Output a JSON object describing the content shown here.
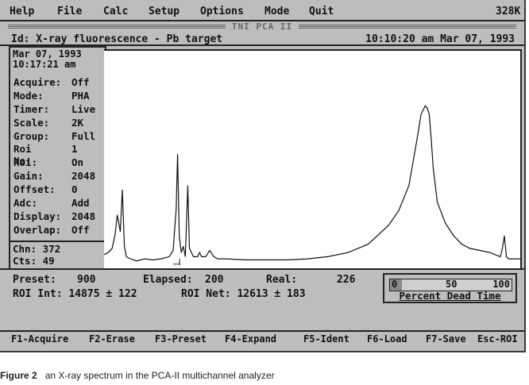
{
  "menu": {
    "items": [
      "Help",
      "File",
      "Calc",
      "Setup",
      "Options",
      "Mode",
      "Quit"
    ],
    "memory": "328K"
  },
  "app_title": "TNI PCA II",
  "header": {
    "id_line": "Id: X-ray fluorescence - Pb target",
    "clock": "10:10:20 am Mar 07, 1993"
  },
  "status": {
    "date": "Mar 07, 1993",
    "time": "10:17:21 am",
    "params": [
      {
        "key": "Acquire:",
        "value": "Off"
      },
      {
        "key": "Mode:",
        "value": "PHA"
      },
      {
        "key": "Timer:",
        "value": "Live"
      },
      {
        "key": "Scale:",
        "value": "2K"
      },
      {
        "key": "Group:",
        "value": "Full"
      },
      {
        "key": "Roi No:",
        "value": "1"
      },
      {
        "key": "Roi:",
        "value": "On"
      },
      {
        "key": "Gain:",
        "value": "2048"
      },
      {
        "key": "Offset:",
        "value": "0"
      },
      {
        "key": "Adc:",
        "value": "Add"
      },
      {
        "key": "Display:",
        "value": "2048"
      },
      {
        "key": "Overlap:",
        "value": "Off"
      }
    ],
    "chn": "Chn: 372",
    "cts": "Cts: 49"
  },
  "info": {
    "preset_label": "Preset:",
    "preset_value": "900",
    "elapsed_label": "Elapsed:",
    "elapsed_value": "200",
    "real_label": "Real:",
    "real_value": "226",
    "roi_int": "ROI Int:  14875 ± 122",
    "roi_net": "ROI Net:  12613 ± 183"
  },
  "dead_time": {
    "ticks": [
      "0",
      "50",
      "100"
    ],
    "label": "Percent Dead Time",
    "percent": 10
  },
  "fkeys": [
    "F1-Acquire",
    "F2-Erase",
    "F3-Preset",
    "F4-Expand",
    "F5-Ident",
    "F6-Load",
    "F7-Save",
    "Esc-ROI"
  ],
  "caption": {
    "label": "Figure 2",
    "text": "an X-ray spectrum in the PCA-II multichannel analyzer"
  },
  "chart_data": {
    "type": "line",
    "title": "",
    "xlabel": "",
    "ylabel": "",
    "xlim": [
      0,
      2048
    ],
    "ylim": [
      0,
      100
    ],
    "grid": false,
    "roi": {
      "start": 340,
      "end": 375
    },
    "cursor_channel": 372,
    "series": [
      {
        "x": [
          0,
          20,
          40,
          55,
          65,
          80,
          90,
          100,
          110,
          130,
          160,
          200,
          240,
          280,
          320,
          340,
          355,
          362,
          370,
          380,
          390,
          400,
          405,
          412,
          420,
          440,
          460,
          470,
          480,
          500,
          520,
          540,
          560,
          600,
          700,
          800,
          900,
          1000,
          1100,
          1200,
          1300,
          1400,
          1450,
          1500,
          1540,
          1560,
          1580,
          1590,
          1600,
          1610,
          1620,
          1640,
          1680,
          1720,
          1760,
          1800,
          1850,
          1900,
          1950,
          1960,
          1970,
          1980,
          1990,
          2000,
          2048
        ],
        "y": [
          5,
          6,
          8,
          15,
          24,
          16,
          36,
          9,
          4,
          3,
          2,
          3,
          2.5,
          3,
          4,
          7,
          27,
          53,
          14,
          6,
          9,
          4,
          18,
          38,
          8,
          4,
          4,
          6,
          4,
          4,
          7,
          4,
          3,
          3,
          2.5,
          2.5,
          2.5,
          3,
          4,
          6,
          10,
          19,
          26,
          38,
          60,
          72,
          76,
          75,
          72,
          60,
          46,
          30,
          20,
          14,
          10,
          8,
          7,
          6,
          4,
          8,
          14,
          4,
          3,
          3,
          3
        ]
      }
    ]
  }
}
